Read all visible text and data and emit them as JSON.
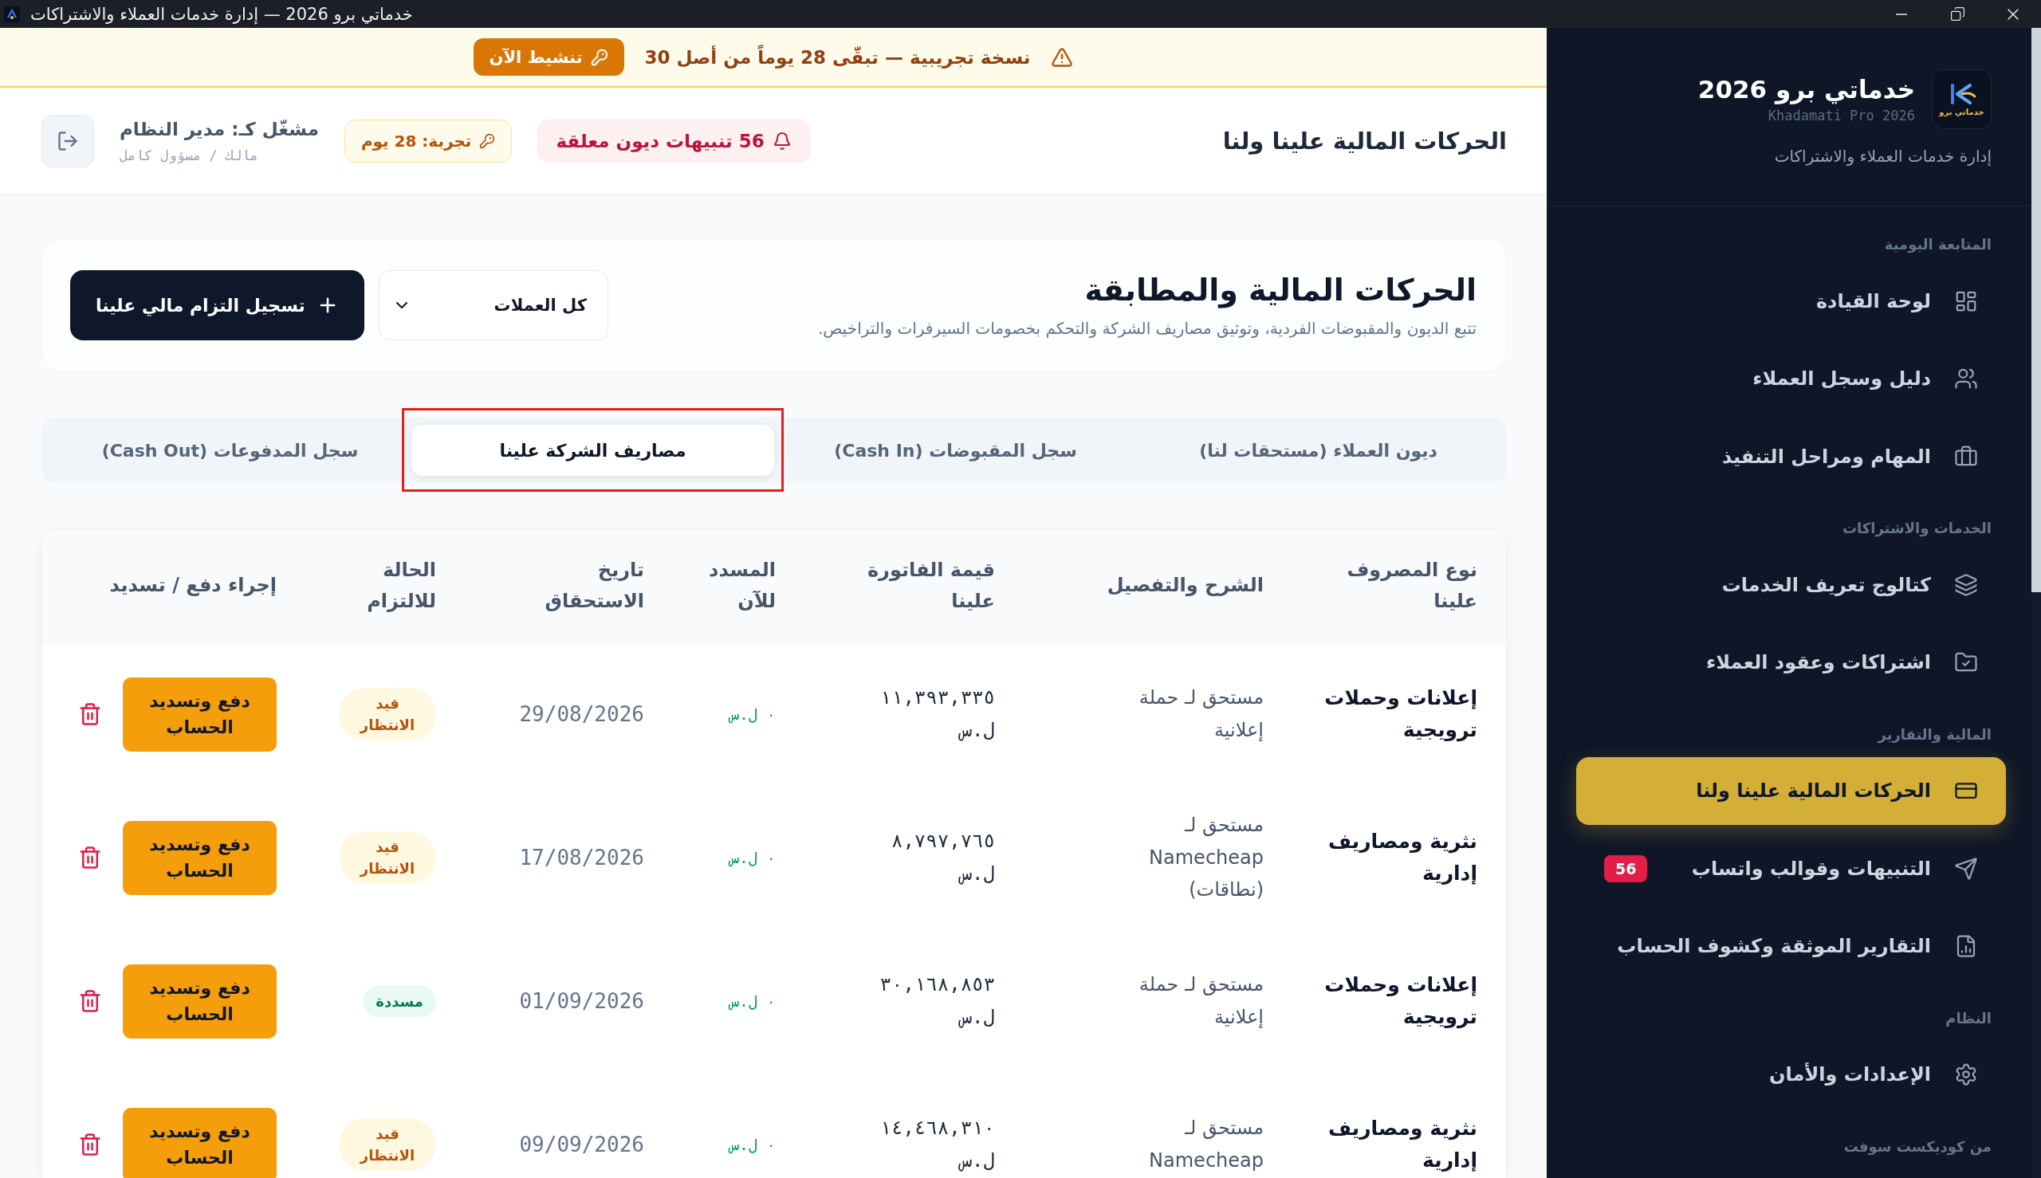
{
  "window": {
    "title": "خدماتي برو 2026 — إدارة خدمات العملاء والاشتراكات"
  },
  "sidebar": {
    "brand": {
      "logo_text": "خدماتي برو",
      "name": "خدماتي برو 2026",
      "latin_name": "Khadamati Pro 2026",
      "tagline": "إدارة خدمات العملاء والاشتراكات"
    },
    "sections": [
      {
        "label": "المتابعة اليومية",
        "items": [
          {
            "label": "لوحة القيادة",
            "selected": false
          },
          {
            "label": "دليل وسجل العملاء",
            "selected": false
          },
          {
            "label": "المهام ومراحل التنفيذ",
            "selected": false
          }
        ]
      },
      {
        "label": "الخدمات والاشتراكات",
        "items": [
          {
            "label": "كتالوج تعريف الخدمات",
            "selected": false
          },
          {
            "label": "اشتراكات وعقود العملاء",
            "selected": false
          }
        ]
      },
      {
        "label": "المالية والتقارير",
        "items": [
          {
            "label": "الحركات المالية علينا ولنا",
            "selected": true
          },
          {
            "label": "التنبيهات وقوالب واتساب",
            "selected": false,
            "badge": "56"
          },
          {
            "label": "التقارير الموثقة وكشوف الحساب",
            "selected": false
          }
        ]
      },
      {
        "label": "النظام",
        "items": [
          {
            "label": "الإعدادات والأمان",
            "selected": false
          }
        ]
      },
      {
        "label": "من كوديكست سوفت"
      }
    ]
  },
  "trial_banner": {
    "message": "نسخة تجريبية — تبقّى 28 يوماً من أصل 30",
    "action": "تنشيط الآن"
  },
  "header": {
    "title": "الحركات المالية علينا ولنا",
    "alerts": "56 تنبيهات ديون معلقة",
    "trial": "تجربة: 28 يوم",
    "user": {
      "name": "مشغّل كـ: مدير النظام",
      "role": "مالك / مسؤول كامل"
    }
  },
  "page": {
    "title": "الحركات المالية والمطابقة",
    "subtitle": "تتبع الديون والمقبوضات الفردية، وتوثيق مصاريف الشركة والتحكم بخصومات السيرفرات والتراخيص.",
    "currency_filter": {
      "value": "كل العملات"
    },
    "primary_action": "تسجيل التزام مالي علينا"
  },
  "tabs": [
    {
      "label": "ديون العملاء (مستحقات لنا)",
      "selected": false,
      "highlighted": false
    },
    {
      "label": "سجل المقبوضات (Cash In)",
      "selected": false,
      "highlighted": false
    },
    {
      "label": "مصاريف الشركة علينا",
      "selected": true,
      "highlighted": true
    },
    {
      "label": "سجل المدفوعات (Cash Out)",
      "selected": false,
      "highlighted": false
    }
  ],
  "table": {
    "columns": [
      "نوع المصروف علينا",
      "الشرح والتفصيل",
      "قيمة الفاتورة علينا",
      "المسدد للآن",
      "تاريخ الاستحقاق",
      "الحالة للالتزام",
      "إجراء دفع / تسديد"
    ],
    "rows": [
      {
        "expense_type": "إعلانات وحملات ترويجية",
        "description": "مستحق لـ حملة إعلانية",
        "invoice_amount": "١١,٣٩٣,٣٣٥ ل.س",
        "paid": "٠ ل.س",
        "due_date": "29/08/2026",
        "status": {
          "label": "قيد الانتظار",
          "kind": "pending"
        },
        "action": "دفع وتسديد الحساب"
      },
      {
        "expense_type": "نثرية ومصاريف إدارية",
        "description": "مستحق لـ Namecheap (نطاقات)",
        "invoice_amount": "٨,٧٩٧,٧٦٥ ل.س",
        "paid": "٠ ل.س",
        "due_date": "17/08/2026",
        "status": {
          "label": "قيد الانتظار",
          "kind": "pending"
        },
        "action": "دفع وتسديد الحساب"
      },
      {
        "expense_type": "إعلانات وحملات ترويجية",
        "description": "مستحق لـ حملة إعلانية",
        "invoice_amount": "٣٠,١٦٨,٨٥٣ ل.س",
        "paid": "٠ ل.س",
        "due_date": "01/09/2026",
        "status": {
          "label": "مسددة",
          "kind": "paid"
        },
        "action": "دفع وتسديد الحساب"
      },
      {
        "expense_type": "نثرية ومصاريف إدارية",
        "description": "مستحق لـ Namecheap",
        "invoice_amount": "١٤,٤٦٨,٣١٠ ل.س",
        "paid": "٠ ل.س",
        "due_date": "09/09/2026",
        "status": {
          "label": "قيد الانتظار",
          "kind": "pending"
        },
        "action": "دفع وتسديد الحساب"
      }
    ]
  }
}
